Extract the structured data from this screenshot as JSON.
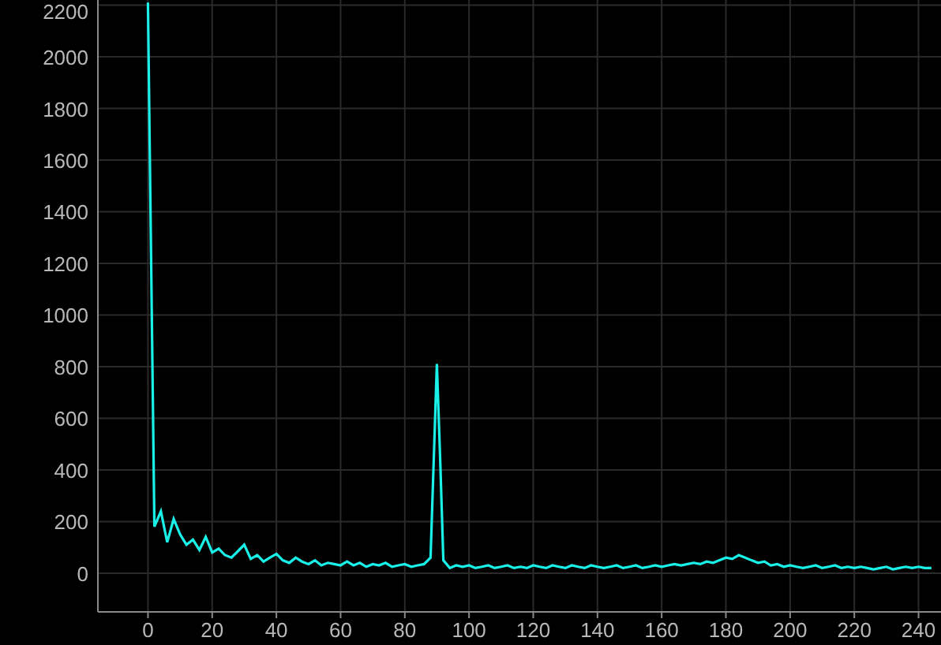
{
  "chart_data": {
    "type": "line",
    "x": [
      0,
      2,
      4,
      6,
      8,
      10,
      12,
      14,
      16,
      18,
      20,
      22,
      24,
      26,
      28,
      30,
      32,
      34,
      36,
      38,
      40,
      42,
      44,
      46,
      48,
      50,
      52,
      54,
      56,
      58,
      60,
      62,
      64,
      66,
      68,
      70,
      72,
      74,
      76,
      78,
      80,
      82,
      84,
      86,
      88,
      90,
      91,
      92,
      94,
      96,
      98,
      100,
      102,
      104,
      106,
      108,
      110,
      112,
      114,
      116,
      118,
      120,
      122,
      124,
      126,
      128,
      130,
      132,
      134,
      136,
      138,
      140,
      142,
      144,
      146,
      148,
      150,
      152,
      154,
      156,
      158,
      160,
      162,
      164,
      166,
      168,
      170,
      172,
      174,
      176,
      178,
      180,
      182,
      184,
      186,
      188,
      190,
      192,
      194,
      196,
      198,
      200,
      202,
      204,
      206,
      208,
      210,
      212,
      214,
      216,
      218,
      220,
      222,
      224,
      226,
      228,
      230,
      232,
      234,
      236,
      238,
      240,
      242,
      244
    ],
    "grid": true,
    "series": [
      {
        "color": "#19f0e8",
        "values": [
          2210,
          180,
          240,
          120,
          210,
          150,
          110,
          130,
          90,
          140,
          80,
          95,
          70,
          60,
          85,
          110,
          55,
          70,
          45,
          60,
          75,
          50,
          40,
          60,
          45,
          35,
          50,
          30,
          40,
          35,
          30,
          45,
          30,
          40,
          25,
          35,
          30,
          40,
          25,
          30,
          35,
          25,
          30,
          35,
          60,
          810,
          440,
          50,
          20,
          30,
          25,
          30,
          20,
          25,
          30,
          20,
          25,
          30,
          20,
          25,
          20,
          30,
          25,
          20,
          30,
          25,
          20,
          30,
          25,
          20,
          30,
          25,
          20,
          25,
          30,
          20,
          25,
          30,
          20,
          25,
          30,
          25,
          30,
          35,
          30,
          35,
          40,
          35,
          45,
          40,
          50,
          60,
          55,
          70,
          60,
          50,
          40,
          45,
          30,
          35,
          25,
          30,
          25,
          20,
          25,
          30,
          20,
          25,
          30,
          20,
          25,
          20,
          25,
          20,
          15,
          20,
          25,
          15,
          20,
          25,
          20,
          25,
          20,
          20
        ]
      }
    ],
    "xlim": [
      -15.6,
      247
    ],
    "ylim": [
      -150,
      2220
    ],
    "xticks": [
      0,
      20,
      40,
      60,
      80,
      100,
      120,
      140,
      160,
      180,
      200,
      220,
      240
    ],
    "yticks": [
      0,
      200,
      400,
      600,
      800,
      1000,
      1200,
      1400,
      1600,
      1800,
      2000,
      2200
    ]
  }
}
